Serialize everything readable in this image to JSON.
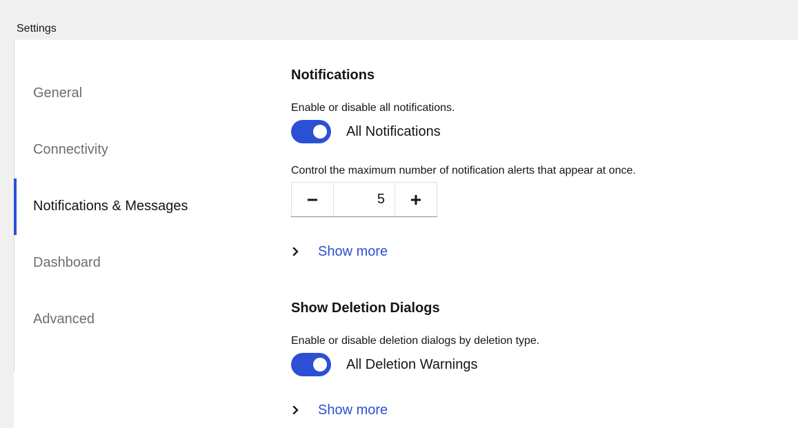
{
  "page": {
    "title": "Settings"
  },
  "sidebar": {
    "items": [
      {
        "label": "General"
      },
      {
        "label": "Connectivity"
      },
      {
        "label": "Notifications & Messages"
      },
      {
        "label": "Dashboard"
      },
      {
        "label": "Advanced"
      }
    ],
    "active": "Notifications & Messages"
  },
  "notifications": {
    "title": "Notifications",
    "description": "Enable or disable all notifications.",
    "toggle_label": "All Notifications",
    "toggle_on": true,
    "max_alerts_description": "Control the maximum number of notification alerts that appear at once.",
    "max_alerts_value": "5",
    "decrement_label": "−",
    "increment_label": "+",
    "show_more_label": "Show more"
  },
  "deletion": {
    "title": "Show Deletion Dialogs",
    "description": "Enable or disable deletion dialogs by deletion type.",
    "toggle_label": "All Deletion Warnings",
    "toggle_on": true,
    "show_more_label": "Show more"
  },
  "colors": {
    "accent": "#2b50d3",
    "muted_text": "#6a6e73",
    "text": "#151515"
  },
  "icons": {
    "chevron": "chevron-right-icon",
    "minus": "minus-icon",
    "plus": "plus-icon"
  }
}
